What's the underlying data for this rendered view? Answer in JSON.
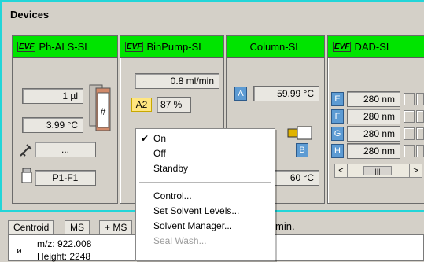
{
  "panel": {
    "title": "Devices"
  },
  "modules": {
    "als": {
      "name": "Ph-ALS-SL",
      "brand": "EVF",
      "volume": "1 µl",
      "temperature": "3.99 °C",
      "vial_badge": "#",
      "needle_value": "...",
      "position_value": "P1-F1"
    },
    "binpump": {
      "name": "BinPump-SL",
      "brand": "EVF",
      "flow": "0.8 ml/min",
      "solvent_label": "A2",
      "solvent_percent": "87 %"
    },
    "column": {
      "name": "Column-SL",
      "left_label": "A",
      "left_temp": "59.99 °C",
      "right_label": "B",
      "right_temp": "60 °C"
    },
    "dad": {
      "name": "DAD-SL",
      "brand": "EVF",
      "channels": [
        {
          "label": "E",
          "value": "280 nm"
        },
        {
          "label": "F",
          "value": "280 nm"
        },
        {
          "label": "G",
          "value": "280 nm"
        },
        {
          "label": "H",
          "value": "280 nm"
        }
      ],
      "scroll_left": "<",
      "scroll_thumb": "|||",
      "scroll_right": ">"
    }
  },
  "context_menu": {
    "items": [
      {
        "label": "On",
        "checked": true,
        "disabled": false
      },
      {
        "label": "Off",
        "checked": false,
        "disabled": false
      },
      {
        "label": "Standby",
        "checked": false,
        "disabled": false
      },
      {
        "label": "Control...",
        "checked": false,
        "disabled": false
      },
      {
        "label": "Set Solvent Levels...",
        "checked": false,
        "disabled": false
      },
      {
        "label": "Solvent Manager...",
        "checked": false,
        "disabled": false
      },
      {
        "label": "Seal Wash...",
        "checked": false,
        "disabled": true
      }
    ],
    "check_glyph": "✔"
  },
  "bottom": {
    "tabs": [
      "Centroid",
      "MS",
      "+ MS"
    ],
    "right_text": "min.",
    "mz_line": "m/z: 922.008",
    "height_line": "Height: 2248",
    "axis_char": "ø"
  }
}
